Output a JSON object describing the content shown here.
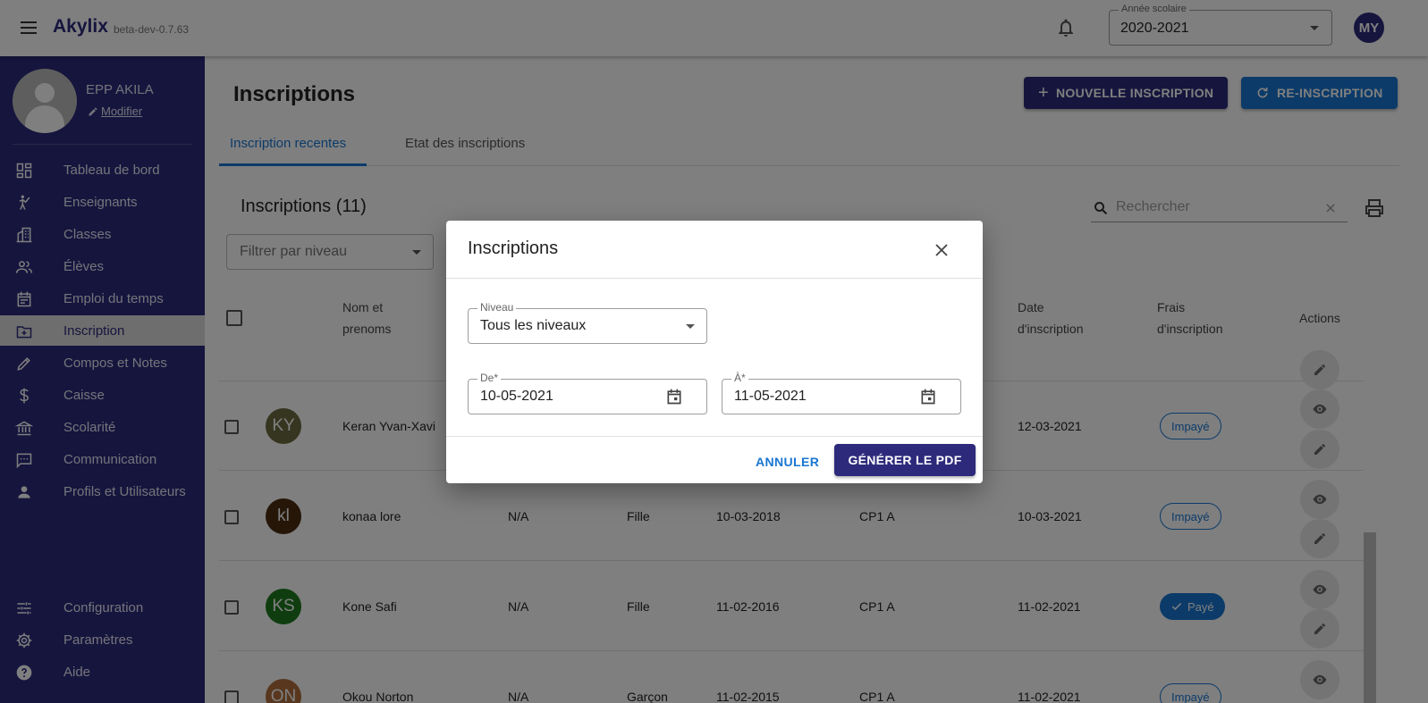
{
  "appbar": {
    "brand": "Akylix",
    "version": "beta-dev-0.7.63",
    "year_label": "Année scolaire",
    "year_value": "2020-2021",
    "user_initials": "MY"
  },
  "sidebar": {
    "school_name": "EPP AKILA",
    "modify_label": "Modifier",
    "items": [
      {
        "label": "Tableau de bord",
        "icon": "dashboard-icon"
      },
      {
        "label": "Enseignants",
        "icon": "teacher-icon"
      },
      {
        "label": "Classes",
        "icon": "classes-icon"
      },
      {
        "label": "Élèves",
        "icon": "students-icon"
      },
      {
        "label": "Emploi du temps",
        "icon": "calendar-icon"
      },
      {
        "label": "Inscription",
        "icon": "inscription-icon",
        "active": true
      },
      {
        "label": "Compos et Notes",
        "icon": "pencil-icon"
      },
      {
        "label": "Caisse",
        "icon": "dollar-icon"
      },
      {
        "label": "Scolarité",
        "icon": "bank-icon"
      },
      {
        "label": "Communication",
        "icon": "chat-icon"
      },
      {
        "label": "Profils et Utilisateurs",
        "icon": "user-icon"
      }
    ],
    "bottom_items": [
      {
        "label": "Configuration",
        "icon": "tune-icon"
      },
      {
        "label": "Paramètres",
        "icon": "gear-icon"
      },
      {
        "label": "Aide",
        "icon": "help-icon"
      }
    ]
  },
  "main": {
    "title": "Inscriptions",
    "new_button": "NOUVELLE INSCRIPTION",
    "reinscription_button": "RE-INSCRIPTION",
    "tabs": [
      "Inscription recentes",
      "Etat des inscriptions"
    ],
    "list_title": "Inscriptions (11)",
    "search_placeholder": "Rechercher",
    "filter_placeholder": "Filtrer par niveau",
    "headers": {
      "name": [
        "Nom et",
        "prenoms"
      ],
      "date": [
        "Date",
        "d'inscription"
      ],
      "fees": [
        "Frais",
        "d'inscription"
      ],
      "actions": "Actions"
    },
    "rows": [
      {
        "initials": "KY",
        "color": "#6b6b40",
        "name": "Keran Yvan-Xavi",
        "matricule": "",
        "gender": "",
        "birth": "",
        "class": "",
        "date": "12-03-2021",
        "fees": "Impayé",
        "paid": false
      },
      {
        "initials": "kl",
        "color": "#4a2c10",
        "name": "konaa lore",
        "matricule": "N/A",
        "gender": "Fille",
        "birth": "10-03-2018",
        "class": "CP1 A",
        "date": "10-03-2021",
        "fees": "Impayé",
        "paid": false
      },
      {
        "initials": "KS",
        "color": "#1e7a1e",
        "name": "Kone Safi",
        "matricule": "N/A",
        "gender": "Fille",
        "birth": "11-02-2016",
        "class": "CP1 A",
        "date": "11-02-2021",
        "fees": "Payé",
        "paid": true
      },
      {
        "initials": "ON",
        "color": "#b06f3d",
        "name": "Okou Norton",
        "matricule": "N/A",
        "gender": "Garçon",
        "birth": "11-02-2015",
        "class": "CP1 A",
        "date": "11-02-2021",
        "fees": "Impayé",
        "paid": false
      }
    ]
  },
  "modal": {
    "title": "Inscriptions",
    "level_label": "Niveau",
    "level_value": "Tous les niveaux",
    "from_label": "De*",
    "from_value": "10-05-2021",
    "to_label": "À*",
    "to_value": "11-05-2021",
    "cancel_label": "ANNULER",
    "generate_label": "GÉNÉRER LE PDF"
  },
  "colors": {
    "brand": "#2d2a7c",
    "accent": "#1976d2"
  }
}
